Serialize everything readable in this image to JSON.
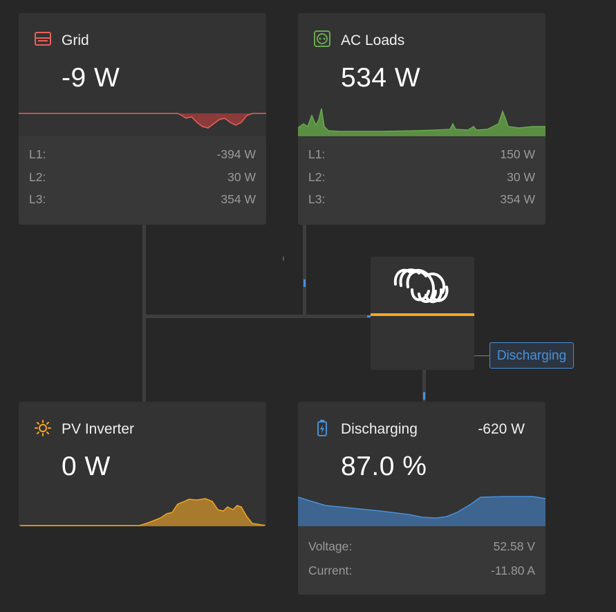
{
  "grid": {
    "title": "Grid",
    "value": "-9 W",
    "rows": [
      {
        "label": "L1:",
        "value": "-394 W"
      },
      {
        "label": "L2:",
        "value": "30 W"
      },
      {
        "label": "L3:",
        "value": "354 W"
      }
    ],
    "color": "#e8615c",
    "icon": "grid-icon"
  },
  "ac_loads": {
    "title": "AC Loads",
    "value": "534 W",
    "rows": [
      {
        "label": "L1:",
        "value": "150 W"
      },
      {
        "label": "L2:",
        "value": "30 W"
      },
      {
        "label": "L3:",
        "value": "354 W"
      }
    ],
    "color": "#6aa84f",
    "icon": "socket-icon"
  },
  "pv_inverter": {
    "title": "PV Inverter",
    "value": "0 W",
    "color": "#f5a623",
    "icon": "sun-icon"
  },
  "battery": {
    "title": "Discharging",
    "power": "-620 W",
    "value": "87.0 %",
    "rows": [
      {
        "label": "Voltage:",
        "value": "52.58 V"
      },
      {
        "label": "Current:",
        "value": "-11.80 A"
      }
    ],
    "color": "#4a90d9",
    "icon": "battery-icon"
  },
  "inverter": {
    "state": "Discharging",
    "logo": "victron-logo",
    "accent": "#f5a623"
  }
}
